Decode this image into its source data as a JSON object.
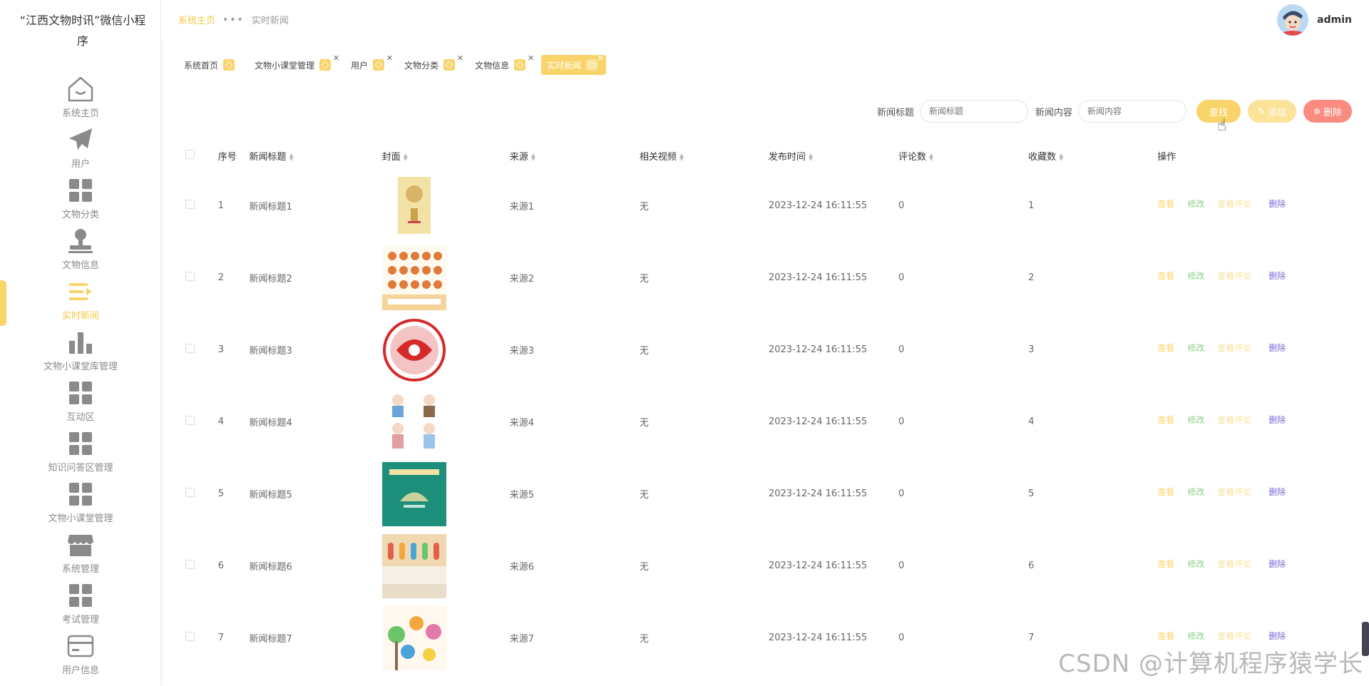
{
  "app_title": "“江西文物时讯”微信小程序",
  "sidebar": {
    "items": [
      {
        "label": "系统主页",
        "icon": "home-icon",
        "active": false
      },
      {
        "label": "用户",
        "icon": "paper-plane-icon",
        "active": false
      },
      {
        "label": "文物分类",
        "icon": "grid-icon",
        "active": false
      },
      {
        "label": "文物信息",
        "icon": "stamp-icon",
        "active": false
      },
      {
        "label": "实时新闻",
        "icon": "list-icon",
        "active": true
      },
      {
        "label": "文物小课堂库管理",
        "icon": "bar-chart-icon",
        "active": false
      },
      {
        "label": "互动区",
        "icon": "grid-icon",
        "active": false
      },
      {
        "label": "知识问答区管理",
        "icon": "grid-icon",
        "active": false
      },
      {
        "label": "文物小课堂管理",
        "icon": "grid-icon",
        "active": false
      },
      {
        "label": "系统管理",
        "icon": "shop-icon",
        "active": false
      },
      {
        "label": "考试管理",
        "icon": "grid-icon",
        "active": false
      },
      {
        "label": "用户信息",
        "icon": "card-icon",
        "active": false
      }
    ]
  },
  "breadcrumb": {
    "home": "系统主页",
    "current": "实时新闻"
  },
  "user": {
    "name": "admin"
  },
  "tags": [
    {
      "label": "系统首页",
      "closable": false,
      "active": false
    },
    {
      "label": "文物小课堂管理",
      "closable": true,
      "active": false
    },
    {
      "label": "用户",
      "closable": true,
      "active": false
    },
    {
      "label": "文物分类",
      "closable": true,
      "active": false
    },
    {
      "label": "文物信息",
      "closable": true,
      "active": false
    },
    {
      "label": "实时新闻",
      "closable": true,
      "active": true
    }
  ],
  "search": {
    "title_label": "新闻标题",
    "title_placeholder": "新闻标题",
    "content_label": "新闻内容",
    "content_placeholder": "新闻内容",
    "find": "查找",
    "add": "添加",
    "delete": "删除"
  },
  "table": {
    "headers": [
      "序号",
      "新闻标题",
      "封面",
      "来源",
      "相关视频",
      "发布时间",
      "评论数",
      "收藏数",
      "操作"
    ],
    "ops": {
      "view": "查看",
      "edit": "修改",
      "comments": "查看评论",
      "delete": "删除"
    },
    "rows": [
      {
        "no": "1",
        "title": "新闻标题1",
        "source": "来源1",
        "video": "无",
        "time": "2023-12-24 16:11:55",
        "comments": "0",
        "favs": "1",
        "cover": "book-cover"
      },
      {
        "no": "2",
        "title": "新闻标题2",
        "source": "来源2",
        "video": "无",
        "time": "2023-12-24 16:11:55",
        "comments": "0",
        "favs": "2",
        "cover": "poster-icons"
      },
      {
        "no": "3",
        "title": "新闻标题3",
        "source": "来源3",
        "video": "无",
        "time": "2023-12-24 16:11:55",
        "comments": "0",
        "favs": "3",
        "cover": "paper-cut-circle"
      },
      {
        "no": "4",
        "title": "新闻标题4",
        "source": "来源4",
        "video": "无",
        "time": "2023-12-24 16:11:55",
        "comments": "0",
        "favs": "4",
        "cover": "figures-illustration"
      },
      {
        "no": "5",
        "title": "新闻标题5",
        "source": "来源5",
        "video": "无",
        "time": "2023-12-24 16:11:55",
        "comments": "0",
        "favs": "5",
        "cover": "green-book"
      },
      {
        "no": "6",
        "title": "新闻标题6",
        "source": "来源6",
        "video": "无",
        "time": "2023-12-24 16:11:55",
        "comments": "0",
        "favs": "6",
        "cover": "wall-display"
      },
      {
        "no": "7",
        "title": "新闻标题7",
        "source": "来源7",
        "video": "无",
        "time": "2023-12-24 16:11:55",
        "comments": "0",
        "favs": "7",
        "cover": "colorful-wall"
      }
    ]
  },
  "watermark": "CSDN @计算机程序猿学长",
  "colors": {
    "accent": "#f9d46a",
    "add": "#fbe39a",
    "danger": "#f98b80",
    "edit": "#8fd18f",
    "delete_link": "#7b6fd6"
  }
}
